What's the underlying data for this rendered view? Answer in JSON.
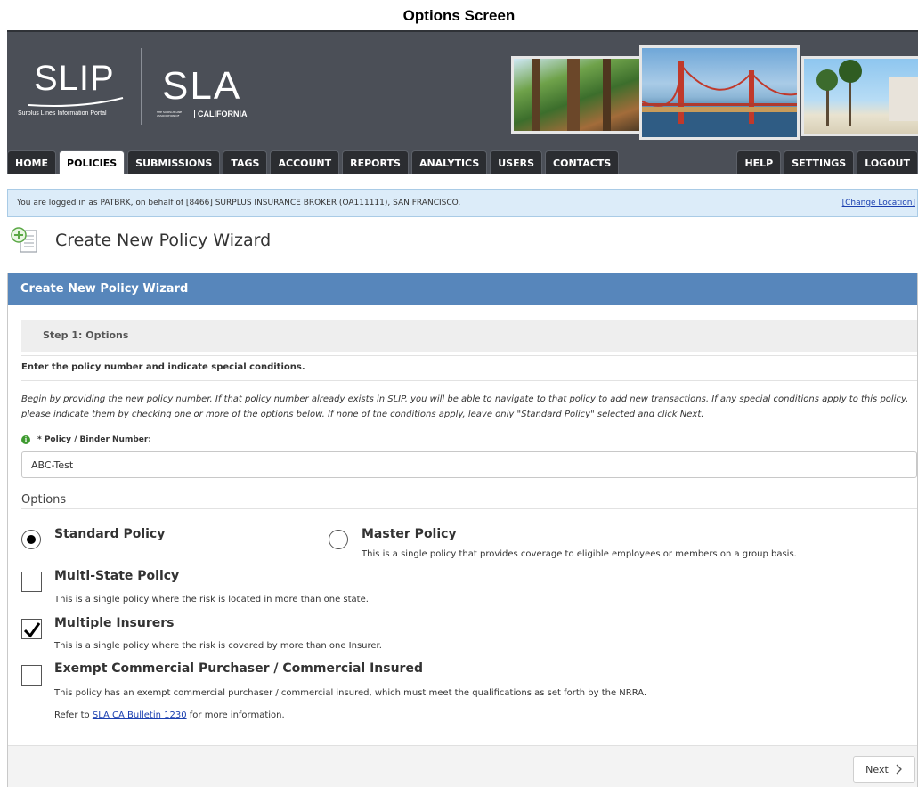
{
  "screen_title": "Options Screen",
  "header": {
    "slip_logo_text": "SLIP",
    "slip_subtitle": "Surplus Lines Information Portal",
    "sla_logo_text": "SLA",
    "sla_assoc_text": "THE SURPLUS LINE ASSOCIATION OF",
    "sla_state_text": "CALIFORNIA"
  },
  "nav": {
    "left_tabs": [
      {
        "label": "HOME"
      },
      {
        "label": "POLICIES"
      },
      {
        "label": "SUBMISSIONS"
      },
      {
        "label": "TAGS"
      },
      {
        "label": "ACCOUNT"
      },
      {
        "label": "REPORTS"
      },
      {
        "label": "ANALYTICS"
      },
      {
        "label": "USERS"
      },
      {
        "label": "CONTACTS"
      }
    ],
    "active_tab": "POLICIES",
    "right_tabs": [
      {
        "label": "HELP"
      },
      {
        "label": "SETTINGS"
      },
      {
        "label": "LOGOUT"
      }
    ]
  },
  "info_bar": {
    "text": "You are logged in as PATBRK, on behalf of [8466] SURPLUS INSURANCE BROKER (OA111111), SAN FRANCISCO.",
    "change_location": "[Change Location]"
  },
  "page": {
    "title": "Create New Policy Wizard"
  },
  "panel": {
    "header": "Create New Policy Wizard",
    "step": "Step 1: Options",
    "instruction_title": "Enter the policy number and indicate special conditions.",
    "instruction_body": "Begin by providing the new policy number. If that policy number already exists in SLIP, you will be able to navigate to that policy to add new transactions. If any special conditions apply to this policy, please indicate them by checking one or more of the options below. If none of the conditions apply, leave only \"Standard Policy\" selected and click Next.",
    "field_label": "* Policy / Binder Number:",
    "policy_number_value": "ABC-Test",
    "options_label": "Options",
    "standard_policy": {
      "title": "Standard Policy",
      "selected": true
    },
    "master_policy": {
      "title": "Master Policy",
      "desc": "This is a single policy that provides coverage to eligible employees or members on a group basis.",
      "selected": false
    },
    "multi_state": {
      "title": "Multi-State Policy",
      "desc": "This is a single policy where the risk is located in more than one state.",
      "checked": false
    },
    "multiple_insurers": {
      "title": "Multiple Insurers",
      "desc": "This is a single policy where the risk is covered by more than one Insurer.",
      "checked": true
    },
    "exempt": {
      "title": "Exempt Commercial Purchaser / Commercial Insured",
      "desc": "This policy has an exempt commercial purchaser / commercial insured, which must meet the qualifications as set forth by the NRRA.",
      "refer_prefix": "Refer to",
      "refer_link": "SLA CA Bulletin 1230",
      "refer_suffix": "for more information.",
      "checked": false
    },
    "next_button": "Next"
  }
}
